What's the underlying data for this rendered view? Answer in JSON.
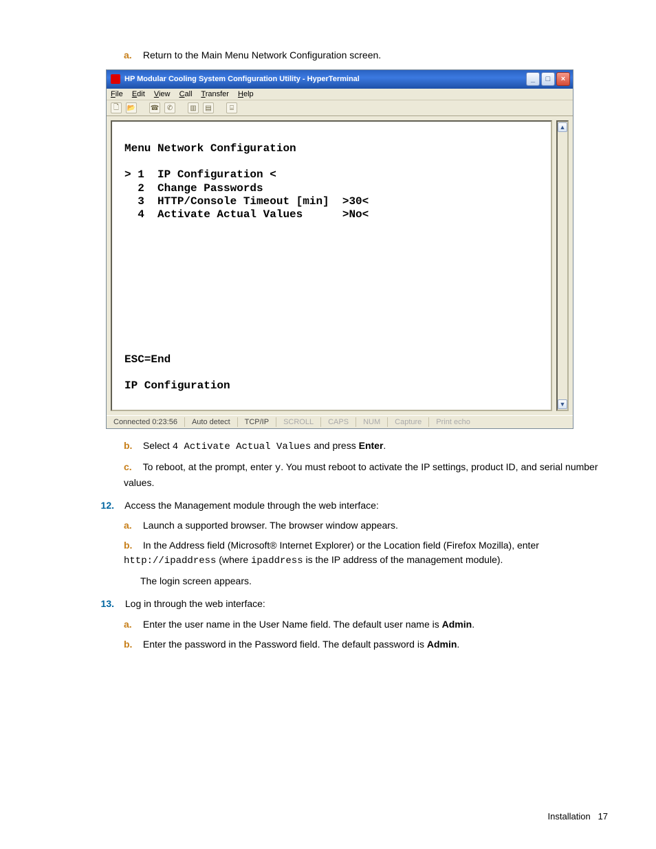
{
  "intro": {
    "a_label": "a.",
    "a_text": "Return to the Main Menu Network Configuration screen."
  },
  "ht": {
    "title": "HP Modular Cooling System Configuration Utility - HyperTerminal",
    "menu": {
      "file": "File",
      "edit": "Edit",
      "view": "View",
      "call": "Call",
      "transfer": "Transfer",
      "help": "Help"
    },
    "body_header": "Menu Network Configuration",
    "row1": "> 1  IP Configuration <",
    "row2": "  2  Change Passwords",
    "row3": "  3  HTTP/Console Timeout [min]  >30<",
    "row4": "  4  Activate Actual Values      >No<",
    "esc": "ESC=End",
    "footer": "IP Configuration",
    "status": {
      "conn": "Connected 0:23:56",
      "auto": "Auto detect",
      "proto": "TCP/IP",
      "scroll": "SCROLL",
      "caps": "CAPS",
      "num": "NUM",
      "capture": "Capture",
      "echo": "Print echo"
    }
  },
  "after": {
    "b_label": "b.",
    "b_pre": "Select ",
    "b_mono": "4 Activate Actual Values",
    "b_mid": " and press ",
    "b_bold": "Enter",
    "b_post": ".",
    "c_label": "c.",
    "c_pre": "To reboot, at the prompt, enter ",
    "c_mono": "y",
    "c_post": ". You must reboot to activate the IP settings, product ID, and serial number values."
  },
  "s12": {
    "num": "12.",
    "text": "Access the Management module through the web interface:",
    "a_label": "a.",
    "a_text": "Launch a supported browser. The browser window appears.",
    "b_label": "b.",
    "b_pre": "In the Address field (Microsoft® Internet Explorer) or the Location field (Firefox Mozilla), enter ",
    "b_mono1": "http://ipaddress",
    "b_mid": " (where ",
    "b_mono2": "ipaddress",
    "b_post": " is the IP address of the management module).",
    "b_line2": "The login screen appears."
  },
  "s13": {
    "num": "13.",
    "text": "Log in through the web interface:",
    "a_label": "a.",
    "a_pre": "Enter the user name in the User Name field. The default user name is ",
    "a_bold": "Admin",
    "a_post": ".",
    "b_label": "b.",
    "b_pre": "Enter the password in the Password field. The default password is ",
    "b_bold": "Admin",
    "b_post": "."
  },
  "pgfoot": {
    "label": "Installation",
    "num": "17"
  }
}
